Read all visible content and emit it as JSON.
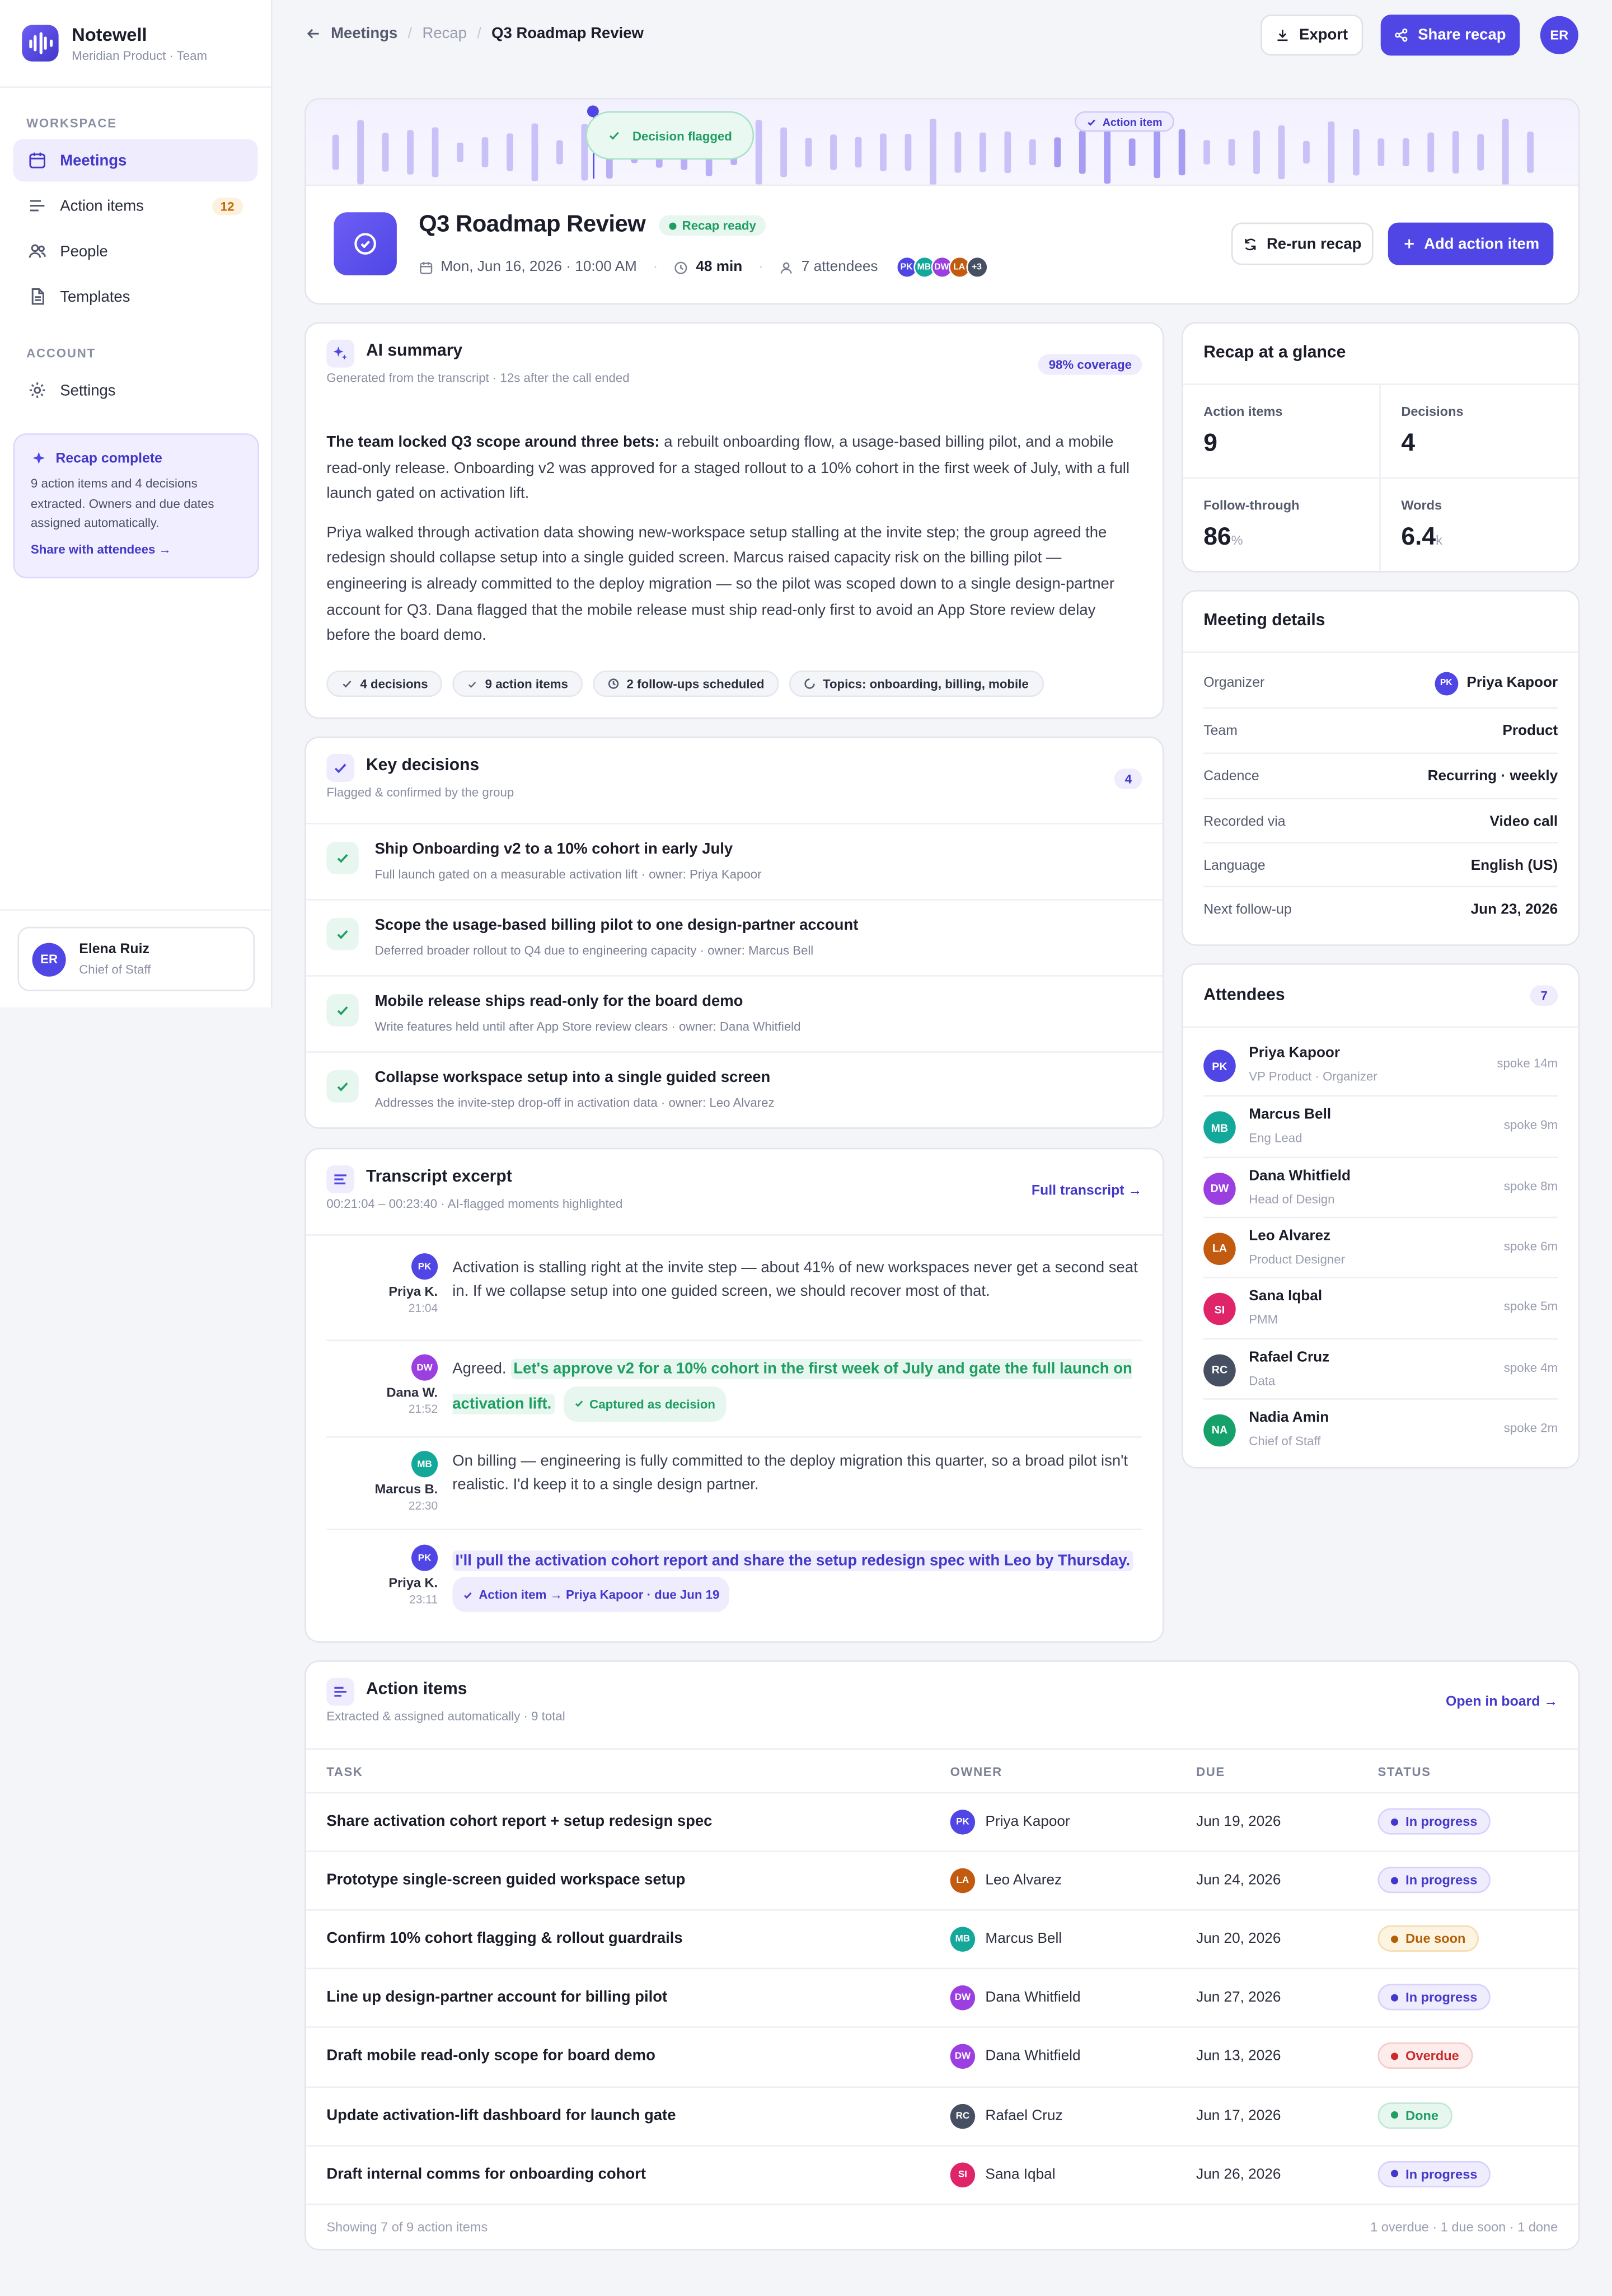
{
  "app": {
    "name": "Notewell",
    "workspace": "Meridian Product · Team"
  },
  "sidebar": {
    "section_workspace": "WORKSPACE",
    "section_account": "ACCOUNT",
    "items": [
      {
        "label": "Meetings",
        "icon": "calendar-icon"
      },
      {
        "label": "Action items",
        "icon": "list-check-icon",
        "badge": "12"
      },
      {
        "label": "People",
        "icon": "people-icon"
      },
      {
        "label": "Templates",
        "icon": "document-icon"
      },
      {
        "label": "Settings",
        "icon": "gear-icon"
      }
    ],
    "promo": {
      "title": "Recap complete",
      "desc": "9 action items and 4 decisions extracted. Owners and due dates assigned automatically.",
      "link": "Share with attendees →"
    },
    "user": {
      "initials": "ER",
      "name": "Elena Ruiz",
      "role": "Chief of Staff"
    }
  },
  "breadcrumb": {
    "back": "Meetings",
    "mid": "Recap",
    "current": "Q3 Roadmap Review"
  },
  "topbar": {
    "export": "Export",
    "share": "Share recap",
    "avatar": "ER"
  },
  "waveform": {
    "flag_decision": "Decision flagged",
    "flag_action": "Action item"
  },
  "meeting": {
    "title": "Q3 Roadmap Review",
    "status": "Recap ready",
    "date": "Mon, Jun 16, 2026 · 10:00 AM",
    "duration": "48 min",
    "attendees": "7 attendees",
    "avatars": [
      "PK",
      "MB",
      "DW",
      "LA",
      "+3"
    ],
    "rerun": "Re-run recap",
    "add_action": "Add action item"
  },
  "summary": {
    "title": "AI summary",
    "subtitle": "Generated from the transcript · 12s after the call ended",
    "coverage": "98% coverage",
    "p1_lead": "The team locked Q3 scope around three bets:",
    "p1_rest": " a rebuilt onboarding flow, a usage-based billing pilot, and a mobile read-only release. Onboarding v2 was approved for a staged rollout to a 10% cohort in the first week of July, with a full launch gated on activation lift.",
    "p2": "Priya walked through activation data showing new-workspace setup stalling at the invite step; the group agreed the redesign should collapse setup into a single guided screen. Marcus raised capacity risk on the billing pilot — engineering is already committed to the deploy migration — so the pilot was scoped down to a single design-partner account for Q3. Dana flagged that the mobile release must ship read-only first to avoid an App Store review delay before the board demo.",
    "tags": [
      "4 decisions",
      "9 action items",
      "2 follow-ups scheduled",
      "Topics: onboarding, billing, mobile"
    ]
  },
  "decisions": {
    "title": "Key decisions",
    "subtitle": "Flagged & confirmed by the group",
    "count": "4",
    "items": [
      {
        "title": "Ship Onboarding v2 to a 10% cohort in early July",
        "sub": "Full launch gated on a measurable activation lift · owner: Priya Kapoor"
      },
      {
        "title": "Scope the usage-based billing pilot to one design-partner account",
        "sub": "Deferred broader rollout to Q4 due to engineering capacity · owner: Marcus Bell"
      },
      {
        "title": "Mobile release ships read-only for the board demo",
        "sub": "Write features held until after App Store review clears · owner: Dana Whitfield"
      },
      {
        "title": "Collapse workspace setup into a single guided screen",
        "sub": "Addresses the invite-step drop-off in activation data · owner: Leo Alvarez"
      }
    ]
  },
  "transcript": {
    "title": "Transcript excerpt",
    "subtitle": "00:21:04 – 00:23:40 · AI-flagged moments highlighted",
    "link": "Full transcript →",
    "rows": [
      {
        "initials": "PK",
        "name": "Priya K.",
        "time": "21:04",
        "text": "Activation is stalling right at the invite step — about 41% of new workspaces never get a second seat in. If we collapse setup into one guided screen, we should recover most of that."
      },
      {
        "initials": "DW",
        "name": "Dana W.",
        "time": "21:52",
        "lead": "Agreed.",
        "highlight": "Let's approve v2 for a 10% cohort in the first week of July and gate the full launch on activation lift.",
        "chip": "Captured as decision"
      },
      {
        "initials": "MB",
        "name": "Marcus B.",
        "time": "22:30",
        "text": "On billing — engineering is fully committed to the deploy migration this quarter, so a broad pilot isn't realistic. I'd keep it to a single design partner."
      },
      {
        "initials": "PK",
        "name": "Priya K.",
        "time": "23:11",
        "highlight": "I'll pull the activation cohort report and share the setup redesign spec with Leo by Thursday.",
        "chip": "Action item → Priya Kapoor · due Jun 19"
      }
    ]
  },
  "glance": {
    "title": "Recap at a glance",
    "stats": [
      {
        "label": "Action items",
        "value": "9",
        "unit": ""
      },
      {
        "label": "Decisions",
        "value": "4",
        "unit": ""
      },
      {
        "label": "Follow-through",
        "value": "86",
        "unit": "%"
      },
      {
        "label": "Words",
        "value": "6.4",
        "unit": "k"
      }
    ]
  },
  "details": {
    "title": "Meeting details",
    "rows": [
      {
        "k": "Organizer",
        "v": "Priya Kapoor",
        "avatar": "PK"
      },
      {
        "k": "Team",
        "v": "Product"
      },
      {
        "k": "Cadence",
        "v": "Recurring · weekly"
      },
      {
        "k": "Recorded via",
        "v": "Video call"
      },
      {
        "k": "Language",
        "v": "English (US)"
      },
      {
        "k": "Next follow-up",
        "v": "Jun 23, 2026"
      }
    ]
  },
  "attendees": {
    "title": "Attendees",
    "count": "7",
    "people": [
      {
        "initials": "PK",
        "name": "Priya Kapoor",
        "role": "VP Product · Organizer",
        "spoke": "spoke 14m",
        "color": "#4f46e5"
      },
      {
        "initials": "MB",
        "name": "Marcus Bell",
        "role": "Eng Lead",
        "spoke": "spoke 9m",
        "color": "#14a89a"
      },
      {
        "initials": "DW",
        "name": "Dana Whitfield",
        "role": "Head of Design",
        "spoke": "spoke 8m",
        "color": "#9b3fe0"
      },
      {
        "initials": "LA",
        "name": "Leo Alvarez",
        "role": "Product Designer",
        "spoke": "spoke 6m",
        "color": "#c25a0f"
      },
      {
        "initials": "SI",
        "name": "Sana Iqbal",
        "role": "PMM",
        "spoke": "spoke 5m",
        "color": "#e0246a"
      },
      {
        "initials": "RC",
        "name": "Rafael Cruz",
        "role": "Data",
        "spoke": "spoke 4m",
        "color": "#475063"
      },
      {
        "initials": "NA",
        "name": "Nadia Amin",
        "role": "Chief of Staff",
        "spoke": "spoke 2m",
        "color": "#16a06a"
      }
    ]
  },
  "actions": {
    "title": "Action items",
    "subtitle": "Extracted & assigned automatically · 9 total",
    "link": "Open in board →",
    "columns": [
      "TASK",
      "OWNER",
      "DUE",
      "STATUS"
    ],
    "rows": [
      {
        "task": "Share activation cohort report + setup redesign spec",
        "owner": "Priya Kapoor",
        "initials": "PK",
        "due": "Jun 19, 2026",
        "status": "In progress"
      },
      {
        "task": "Prototype single-screen guided workspace setup",
        "owner": "Leo Alvarez",
        "initials": "LA",
        "due": "Jun 24, 2026",
        "status": "In progress"
      },
      {
        "task": "Confirm 10% cohort flagging & rollout guardrails",
        "owner": "Marcus Bell",
        "initials": "MB",
        "due": "Jun 20, 2026",
        "status": "Due soon"
      },
      {
        "task": "Line up design-partner account for billing pilot",
        "owner": "Dana Whitfield",
        "initials": "DW",
        "due": "Jun 27, 2026",
        "status": "In progress"
      },
      {
        "task": "Draft mobile read-only scope for board demo",
        "owner": "Dana Whitfield",
        "initials": "DW",
        "due": "Jun 13, 2026",
        "status": "Overdue"
      },
      {
        "task": "Update activation-lift dashboard for launch gate",
        "owner": "Rafael Cruz",
        "initials": "RC",
        "due": "Jun 17, 2026",
        "status": "Done"
      },
      {
        "task": "Draft internal comms for onboarding cohort",
        "owner": "Sana Iqbal",
        "initials": "SI",
        "due": "Jun 26, 2026",
        "status": "In progress"
      }
    ],
    "footer_left": "Showing 7 of 9 action items",
    "footer_right": "1 overdue · 1 due soon · 1 done"
  }
}
